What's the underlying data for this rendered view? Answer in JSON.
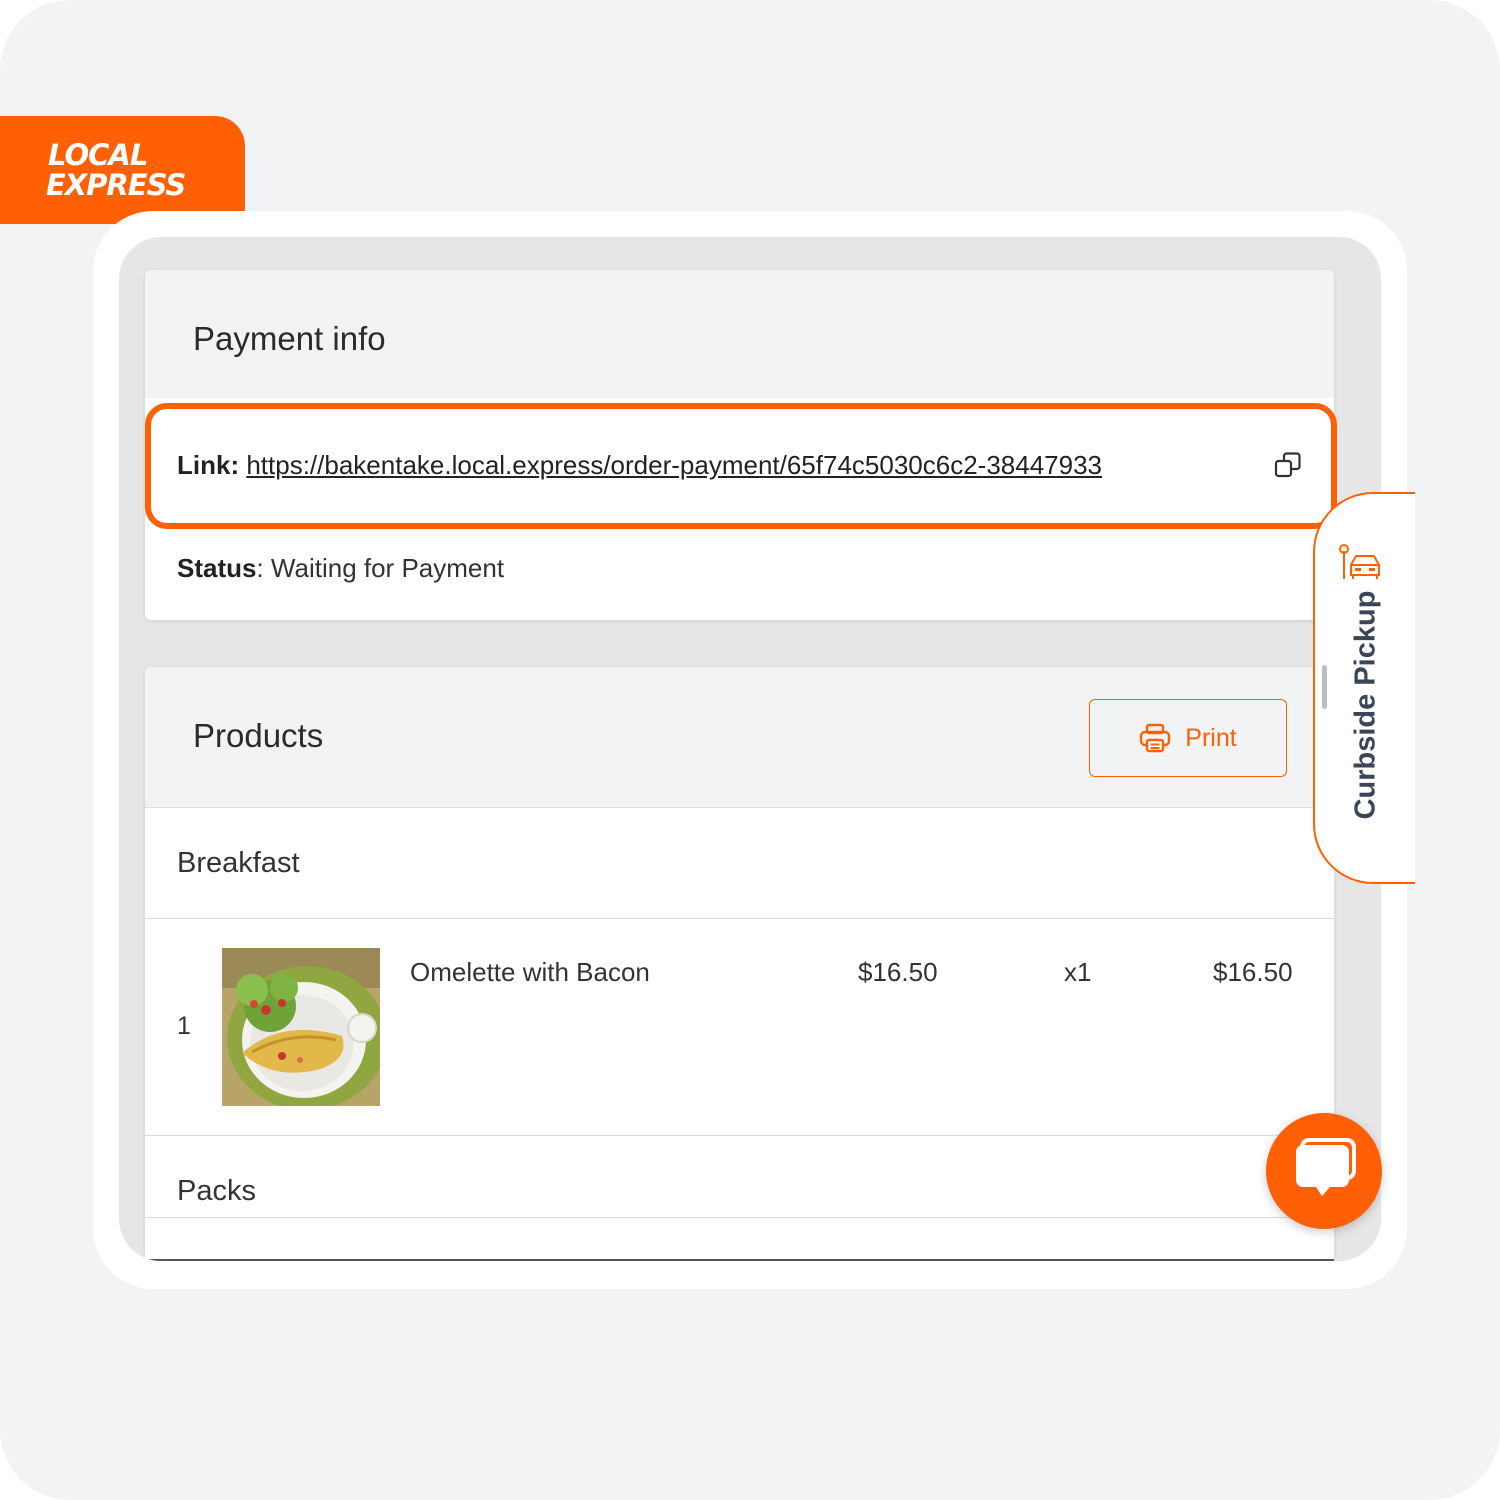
{
  "brand": {
    "line1": "LOCAL",
    "line2": "EXPRESS",
    "color": "#ff6005"
  },
  "payment_info": {
    "title": "Payment info",
    "link_label": "Link:",
    "link_url": "https://bakentake.local.express/order-payment/65f74c5030c6c2-38447933",
    "status_label": "Status",
    "status_sep": ": ",
    "status_value": "Waiting for Payment"
  },
  "products": {
    "title": "Products",
    "print_label": "Print",
    "sections": [
      {
        "name": "Breakfast",
        "items": [
          {
            "index": "1",
            "name": "Omelette with Bacon",
            "price": "$16.50",
            "qty": "x1",
            "total": "$16.50"
          }
        ]
      },
      {
        "name": "Packs",
        "items": []
      }
    ]
  },
  "side_tab": {
    "label": "Curbside Pickup",
    "icon": "car-pickup-icon"
  },
  "chat": {
    "icon": "chat-bubble-icon"
  },
  "colors": {
    "accent": "#ff6005",
    "heading": "#2b2b2b",
    "side_label": "#3a4558"
  }
}
